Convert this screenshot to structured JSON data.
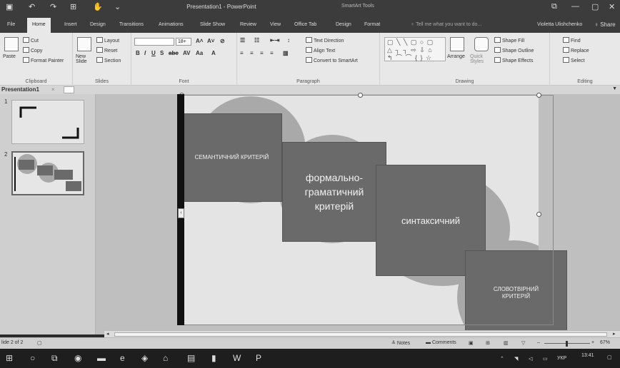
{
  "titlebar": {
    "title": "Presentation1 - PowerPoint",
    "contextual_tools": "SmartArt Tools",
    "minimize": "—",
    "maximize": "▢",
    "close": "✕",
    "restore": "⧉"
  },
  "tabs": {
    "file": "File",
    "home": "Home",
    "insert": "Insert",
    "design": "Design",
    "transitions": "Transitions",
    "animations": "Animations",
    "slideshow": "Slide Show",
    "review": "Review",
    "view": "View",
    "officetab": "Office Tab",
    "design2": "Design",
    "format": "Format",
    "tellme": "♀ Tell me what you want to do...",
    "user": "Violetta Ulishchenko",
    "share": "♀ Share"
  },
  "ribbon": {
    "clipboard": {
      "paste": "Paste",
      "cut": "Cut",
      "copy": "Copy",
      "format_painter": "Format Painter",
      "label": "Clipboard"
    },
    "slides": {
      "new_slide": "New Slide",
      "layout": "Layout",
      "reset": "Reset",
      "section": "Section",
      "label": "Slides"
    },
    "font": {
      "size": "18+",
      "label": "Font"
    },
    "paragraph": {
      "text_direction": "Text Direction",
      "align_text": "Align Text",
      "convert": "Convert to SmartArt",
      "label": "Paragraph"
    },
    "drawing": {
      "arrange": "Arrange",
      "quick_styles": "Quick Styles",
      "shape_fill": "Shape Fill",
      "shape_outline": "Shape Outline",
      "shape_effects": "Shape Effects",
      "label": "Drawing"
    },
    "editing": {
      "find": "Find",
      "replace": "Replace",
      "select": "Select",
      "label": "Editing"
    }
  },
  "document": {
    "tab": "Presentation1",
    "close": "×"
  },
  "thumbnails": [
    {
      "number": "1"
    },
    {
      "number": "2"
    }
  ],
  "slide": {
    "boxes": [
      {
        "text": "СЕМАНТИЧНИЙ КРИТЕРІЙ"
      },
      {
        "text": "формально-граматичний критерій"
      },
      {
        "text": "синтаксичний"
      },
      {
        "text": "СЛОВОТВІРНИЙ КРИТЕРІЙ"
      }
    ]
  },
  "status": {
    "slide_info": "lide 2 of 2",
    "notes": "Notes",
    "comments": "Comments",
    "zoom": "67%"
  },
  "taskbar": {
    "lang": "УКР",
    "time": "13:41"
  }
}
